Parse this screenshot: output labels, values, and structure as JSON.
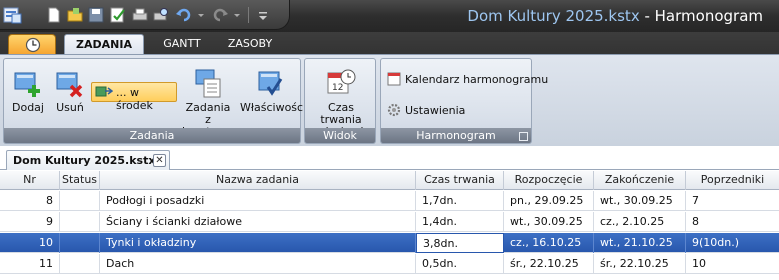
{
  "window": {
    "file_name": "Dom Kultury 2025.kstx",
    "separator": " - ",
    "app_name": "Harmonogram"
  },
  "quick_access": {
    "icons": [
      "app-icon",
      "new-document-icon",
      "open-folder-icon",
      "save-icon",
      "checkmark-icon",
      "print-icon",
      "print-preview-icon",
      "undo-icon",
      "redo-icon"
    ]
  },
  "tabs": [
    {
      "label": "ZADANIA",
      "active": true
    },
    {
      "label": "GANTT",
      "active": false
    },
    {
      "label": "ZASOBY",
      "active": false
    }
  ],
  "ribbon": {
    "zadania": {
      "group_label": "Zadania",
      "add_label": "Dodaj",
      "delete_label": "Usuń",
      "middle_label": "... w środek",
      "from_estimate_label_1": "Zadania z",
      "from_estimate_label_2": "kosztorysu",
      "properties_label": "Właściwości"
    },
    "widok": {
      "group_label": "Widok",
      "duration_label_1": "Czas trwania",
      "duration_label_2": "w dn./godz."
    },
    "harmonogram": {
      "group_label": "Harmonogram",
      "calendar_label": "Kalendarz harmonogramu",
      "settings_label": "Ustawienia"
    }
  },
  "document_tab": {
    "label": "Dom Kultury 2025.kstx",
    "close": "✕"
  },
  "grid": {
    "headers": {
      "nr": "Nr",
      "status": "Status",
      "name": "Nazwa zadania",
      "duration": "Czas trwania",
      "start": "Rozpoczęcie",
      "end": "Zakończenie",
      "predecessors": "Poprzedniki"
    },
    "rows": [
      {
        "nr": "8",
        "name": "Podłogi i posadzki",
        "duration": "1,7dn.",
        "start": "pn., 29.09.25",
        "end": "wt., 30.09.25",
        "pred": "7",
        "selected": false
      },
      {
        "nr": "9",
        "name": "Ściany i ścianki działowe",
        "duration": "1,4dn.",
        "start": "wt., 30.09.25",
        "end": "cz., 2.10.25",
        "pred": "8",
        "selected": false
      },
      {
        "nr": "10",
        "name": "Tynki i okładziny",
        "duration": "3,8dn.",
        "start": "cz., 16.10.25",
        "end": "wt., 21.10.25",
        "pred": "9(10dn.)",
        "selected": true
      },
      {
        "nr": "11",
        "name": "Dach",
        "duration": "0,5dn.",
        "start": "śr., 22.10.25",
        "end": "śr., 22.10.25",
        "pred": "10",
        "selected": false
      }
    ]
  }
}
